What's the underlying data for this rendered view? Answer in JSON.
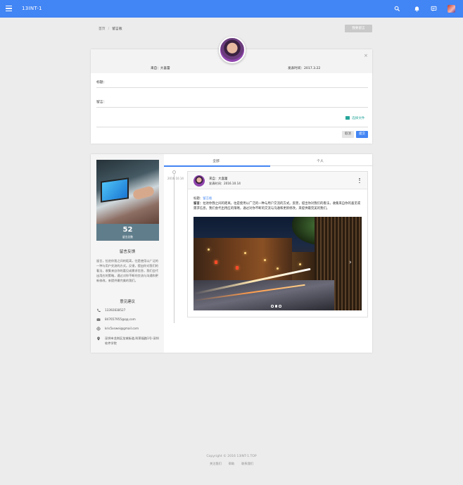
{
  "app": {
    "brand": "13INT-1"
  },
  "topbar": {
    "icons": [
      "menu-icon",
      "search-icon",
      "bell-icon",
      "message-icon",
      "avatar"
    ]
  },
  "breadcrumb": {
    "home": "首页",
    "separator": "/",
    "current": "留言板"
  },
  "actions": {
    "leave_message": "我要留言"
  },
  "compose": {
    "from": "来自：大喜蕾",
    "time": "发表时间：2017.3.22",
    "title_label": "标题：",
    "message_label": "留言：",
    "attach_label": "选择文件",
    "cancel_label": "取消",
    "submit_label": "提交"
  },
  "profile": {
    "stat_value": "52",
    "stat_caption": "留言总数",
    "feedback_title": "留言反馈",
    "feedback_text": "留言，拉进你我之间的距离，往是使用以广泛的一种与用户交流的方式。反馈，提出你对我们的看法，收集来自你的喜见或需求信息，我们会代出用应的策略，通过对你不断的交流与沟通和更新修改，来提供最完美的我们。",
    "suggest_title": "意见建议",
    "contacts": [
      {
        "icon": "phone-icon",
        "text": "13392838527"
      },
      {
        "icon": "email-icon",
        "text": "847657955@qq.com"
      },
      {
        "icon": "globe-icon",
        "text": "kris5xswei@gmail.com"
      },
      {
        "icon": "location-icon",
        "text": "深圳市龙岗区龙城街道,科莱福路1号-深圳软件学院"
      }
    ]
  },
  "tabs": [
    {
      "label": "全部",
      "active": true
    },
    {
      "label": "个人",
      "active": false
    }
  ],
  "timeline": {
    "date": "2016.10.14"
  },
  "post": {
    "from": "来自：大喜蕾",
    "time": "发表时间：2016.10.14",
    "title_prefix": "标题：",
    "title_link": "留言板",
    "body_prefix": "留言：",
    "body_text": "拉进你我之间的距离，往是使用以广泛的一种与用户交流的方式。反馈，提出你对我们的看法，收集来自你的喜见或需求信息，我们会代出用应的策略，通过对你不断的交流与沟通和更新修改，来提供最完美的我们。",
    "slide_dots": 3,
    "active_dot": 1
  },
  "footer": {
    "copyright": "Copyright © 2016 13INT-1.TOP",
    "links": [
      "关注我们",
      "帮助",
      "联系我们"
    ]
  },
  "colors": {
    "primary": "#4285f4",
    "accent": "#26a69a",
    "stat_bg": "#607d8b"
  }
}
